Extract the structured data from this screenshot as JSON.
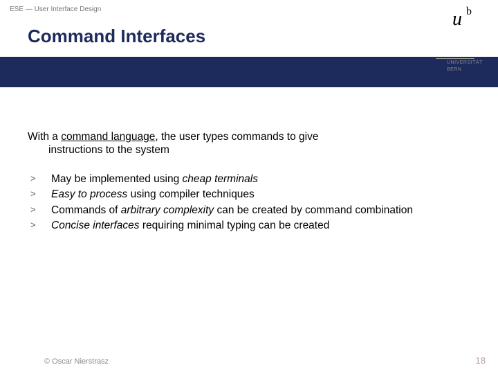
{
  "header_small": "ESE — User Interface Design",
  "title": "Command Interfaces",
  "logo": {
    "u": "u",
    "b": "b",
    "line1": "UNIVERSITÄT",
    "line2": "BERN"
  },
  "intro": {
    "pre": "With a ",
    "keyword": "command language",
    "post": ", the user types commands to give",
    "line2": "instructions to the system"
  },
  "bullets": {
    "marker": ">",
    "items": [
      {
        "pre": "May be implemented using ",
        "em": "cheap terminals",
        "post": ""
      },
      {
        "pre": "",
        "em": "Easy to process",
        "post": " using compiler techniques"
      },
      {
        "pre": "Commands of ",
        "em": "arbitrary complexity",
        "post": " can be created by command combination"
      },
      {
        "pre": "",
        "em": "Concise interfaces",
        "post": " requiring minimal typing can be created"
      }
    ]
  },
  "footer": "© Oscar Nierstrasz",
  "page": "18"
}
